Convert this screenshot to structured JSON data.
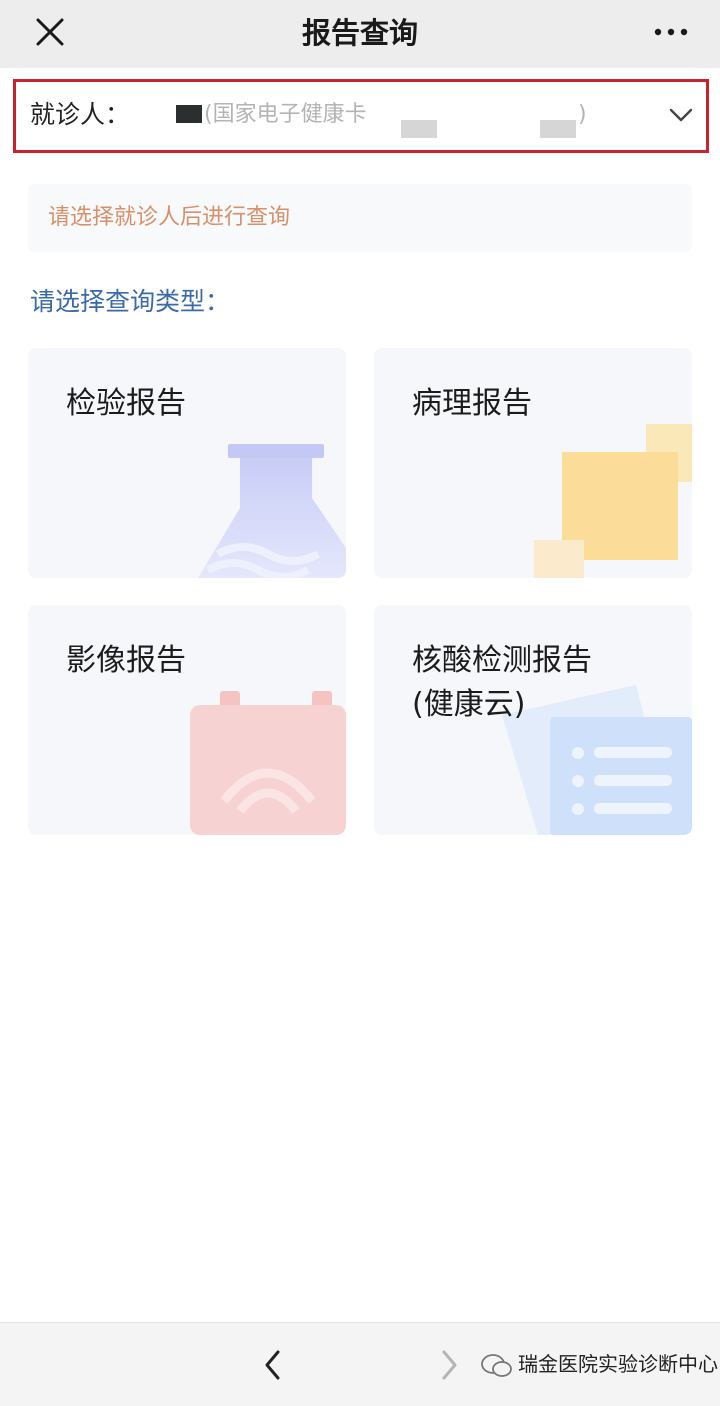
{
  "header": {
    "title": "报告查询",
    "close_icon": "close-icon",
    "more_icon": "more-dots-icon"
  },
  "patient": {
    "label": "就诊人：",
    "card_text": "(国家电子健康卡",
    "card_close": ")",
    "dropdown_icon": "chevron-down-icon"
  },
  "notice": {
    "text": "请选择就诊人后进行查询",
    "color": "#d9906a"
  },
  "section": {
    "label": "请选择查询类型："
  },
  "cards": [
    {
      "title": "检验报告",
      "icon": "flask-icon"
    },
    {
      "title": "病理报告",
      "icon": "pathology-icon"
    },
    {
      "title": "影像报告",
      "icon": "imaging-icon"
    },
    {
      "title": "核酸检测报告\n(健康云)",
      "icon": "document-list-icon"
    }
  ],
  "bottom_nav": {
    "back_icon": "chevron-left-icon",
    "forward_icon": "chevron-right-icon"
  },
  "watermark": {
    "text": "瑞金医院实验诊断中心",
    "icon": "wechat-icon"
  },
  "colors": {
    "highlight_border": "#c8232c",
    "section_label": "#3a6aa8",
    "top_bar": "#ededed"
  }
}
